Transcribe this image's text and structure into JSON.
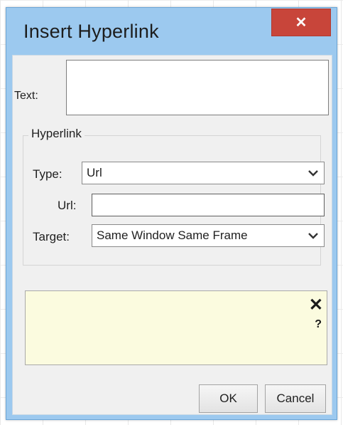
{
  "dialog": {
    "title": "Insert Hyperlink",
    "close_glyph": "✕"
  },
  "text_field": {
    "label": "Text:",
    "value": ""
  },
  "hyperlink_group": {
    "legend": "Hyperlink",
    "type": {
      "label": "Type:",
      "selected": "Url"
    },
    "url": {
      "label": "Url:",
      "value": ""
    },
    "target": {
      "label": "Target:",
      "selected": "Same Window Same Frame"
    }
  },
  "help_panel": {
    "close_glyph": "✕",
    "help_glyph": "?"
  },
  "buttons": {
    "ok": "OK",
    "cancel": "Cancel"
  },
  "icons": {
    "dropdown": "chevron-down-icon",
    "close": "close-icon",
    "help": "question-icon"
  },
  "colors": {
    "title_bar": "#9cc9ef",
    "close_button": "#c8453a",
    "help_background": "#fbfbdf"
  }
}
